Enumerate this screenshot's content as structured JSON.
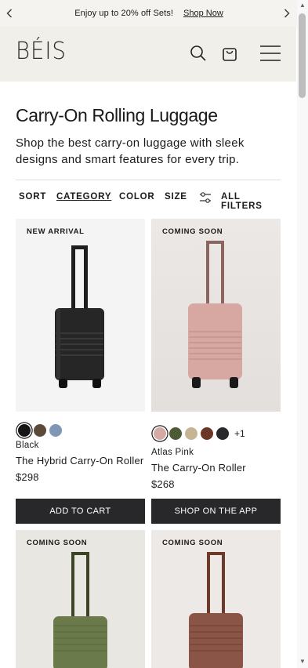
{
  "promo": {
    "text": "Enjoy up to 20% off Sets!",
    "link": "Shop Now"
  },
  "header": {
    "logo": "BÉIS",
    "icons": [
      "search-icon",
      "shopping-bag-icon",
      "menu-icon"
    ]
  },
  "page": {
    "title": "Carry-On Rolling Luggage",
    "description": "Shop the best carry-on luggage with sleek designs and smart features for every trip."
  },
  "filters": {
    "sort": "SORT",
    "category": "CATEGORY",
    "color": "COLOR",
    "size": "SIZE",
    "all_filters": "ALL FILTERS"
  },
  "products": [
    {
      "tag": "NEW ARRIVAL",
      "color_name": "Black",
      "name": "The Hybrid Carry-On Roller",
      "price": "$298",
      "button": "ADD TO CART",
      "swatches": [
        "#151515",
        "#5b4a3a",
        "#7f97b5"
      ]
    },
    {
      "tag": "COMING SOON",
      "color_name": "Atlas Pink",
      "name": "The Carry-On Roller",
      "price": "$268",
      "button": "SHOP ON THE APP",
      "swatches": [
        "#d6aaa4",
        "#4d5a36",
        "#c7b494",
        "#6a3626",
        "#29292c"
      ],
      "more": "+1"
    },
    {
      "tag": "COMING SOON"
    },
    {
      "tag": "COMING SOON"
    }
  ],
  "colors": {
    "button_bg": "#28282a",
    "header_bg": "#f1efe9"
  }
}
